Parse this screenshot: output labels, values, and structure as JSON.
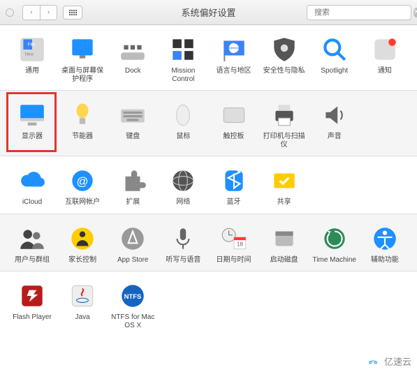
{
  "window": {
    "title": "系统偏好设置",
    "search_placeholder": "搜索"
  },
  "rows": [
    {
      "alt": false,
      "items": [
        {
          "id": "general",
          "label": "通用"
        },
        {
          "id": "desktop",
          "label": "桌面与屏幕保护程序"
        },
        {
          "id": "dock",
          "label": "Dock"
        },
        {
          "id": "mission",
          "label": "Mission Control"
        },
        {
          "id": "language",
          "label": "语言与地区"
        },
        {
          "id": "security",
          "label": "安全性与隐私"
        },
        {
          "id": "spotlight",
          "label": "Spotlight"
        },
        {
          "id": "notifications",
          "label": "通知"
        }
      ]
    },
    {
      "alt": true,
      "items": [
        {
          "id": "displays",
          "label": "显示器"
        },
        {
          "id": "energy",
          "label": "节能器"
        },
        {
          "id": "keyboard",
          "label": "键盘"
        },
        {
          "id": "mouse",
          "label": "鼠标"
        },
        {
          "id": "trackpad",
          "label": "触控板"
        },
        {
          "id": "printers",
          "label": "打印机与扫描仪"
        },
        {
          "id": "sound",
          "label": "声音"
        }
      ]
    },
    {
      "alt": false,
      "items": [
        {
          "id": "icloud",
          "label": "iCloud"
        },
        {
          "id": "internet",
          "label": "互联网帐户"
        },
        {
          "id": "extensions",
          "label": "扩展"
        },
        {
          "id": "network",
          "label": "网络"
        },
        {
          "id": "bluetooth",
          "label": "蓝牙"
        },
        {
          "id": "sharing",
          "label": "共享"
        }
      ]
    },
    {
      "alt": true,
      "items": [
        {
          "id": "users",
          "label": "用户与群组"
        },
        {
          "id": "parental",
          "label": "家长控制"
        },
        {
          "id": "appstore",
          "label": "App Store"
        },
        {
          "id": "dictation",
          "label": "听写与语音"
        },
        {
          "id": "datetime",
          "label": "日期与时间"
        },
        {
          "id": "startup",
          "label": "启动磁盘"
        },
        {
          "id": "timemachine",
          "label": "Time Machine"
        },
        {
          "id": "accessibility",
          "label": "辅助功能"
        }
      ]
    },
    {
      "alt": false,
      "items": [
        {
          "id": "flash",
          "label": "Flash Player"
        },
        {
          "id": "java",
          "label": "Java"
        },
        {
          "id": "ntfs",
          "label": "NTFS for Mac OS X"
        }
      ]
    }
  ],
  "watermark": "亿速云"
}
